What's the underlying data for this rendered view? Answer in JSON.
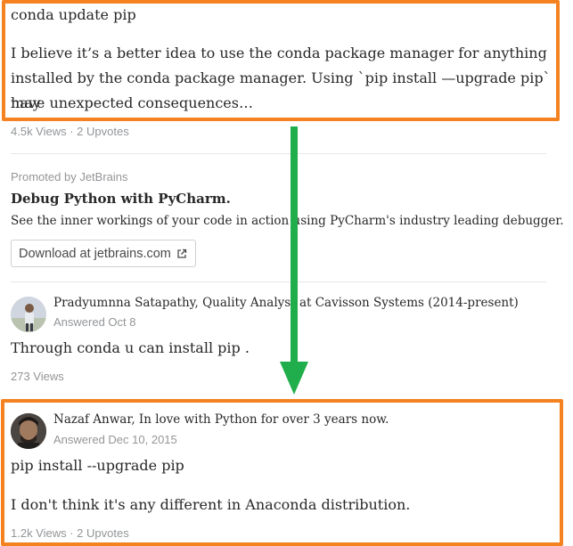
{
  "answer1": {
    "line1": "conda update pip",
    "para": [
      "I believe it’s a better idea to use the conda package manager for anything",
      "installed by the conda package manager. Using `pip install —upgrade pip` may",
      "have unexpected consequences…"
    ],
    "meta": "4.5k Views · 2 Upvotes"
  },
  "promo": {
    "label": "Promoted by JetBrains",
    "title": "Debug Python with PyCharm.",
    "body": "See the inner workings of your code in action using PyCharm's industry leading debugger.",
    "button_label": "Download at jetbrains.com",
    "button_icon": "external-link-icon"
  },
  "answer2": {
    "author": "Pradyumnna Satapathy, Quality Analyst at Cavisson Systems (2014-present)",
    "answered": "Answered Oct 8",
    "text": "Through conda u can install pip .",
    "meta": "273 Views"
  },
  "answer3": {
    "author": "Nazaf Anwar, In love with Python for over 3 years now.",
    "answered": "Answered Dec 10, 2015",
    "line1": "pip install --upgrade pip",
    "line2": "I don't think it's any different in Anaconda distribution.",
    "meta": "1.2k Views · 2 Upvotes"
  },
  "annotation": {
    "highlight_color": "#f58220",
    "arrow_color": "#1fae4b"
  }
}
